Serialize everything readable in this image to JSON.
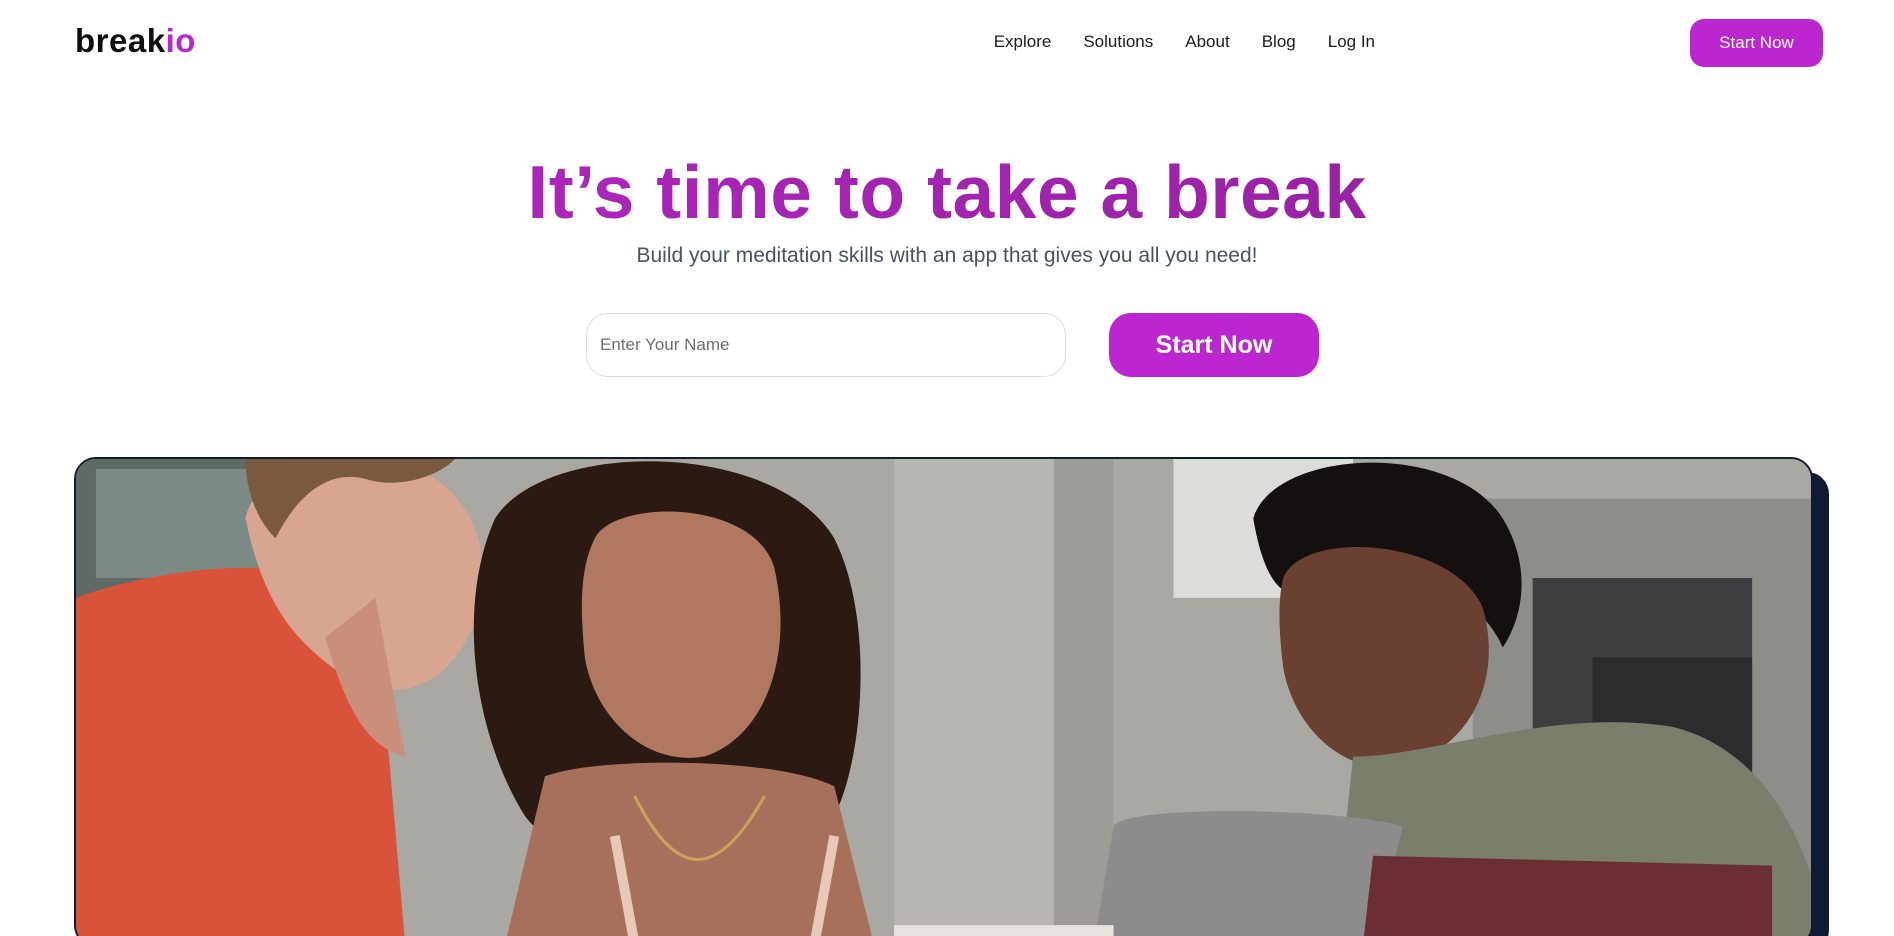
{
  "brand": {
    "name_main": "break",
    "name_accent": "io",
    "accent_color": "#b726cf"
  },
  "nav": {
    "links": [
      "Explore",
      "Solutions",
      "About",
      "Blog",
      "Log In"
    ],
    "cta_label": "Start Now"
  },
  "hero": {
    "title": "It’s time to take a break",
    "subtitle": "Build your meditation skills with an app that gives you all you need!",
    "name_input": {
      "placeholder": "Enter Your Name",
      "value": ""
    },
    "cta_label": "Start Now"
  },
  "photo": {
    "icon": "photo-three-people-laptop",
    "frame_color": "#0f1a33"
  },
  "colors": {
    "primary": "#bb26d0",
    "title_gradient_start": "#b728c9",
    "title_gradient_end": "#8e1e96",
    "subtitle": "#4a5160"
  }
}
